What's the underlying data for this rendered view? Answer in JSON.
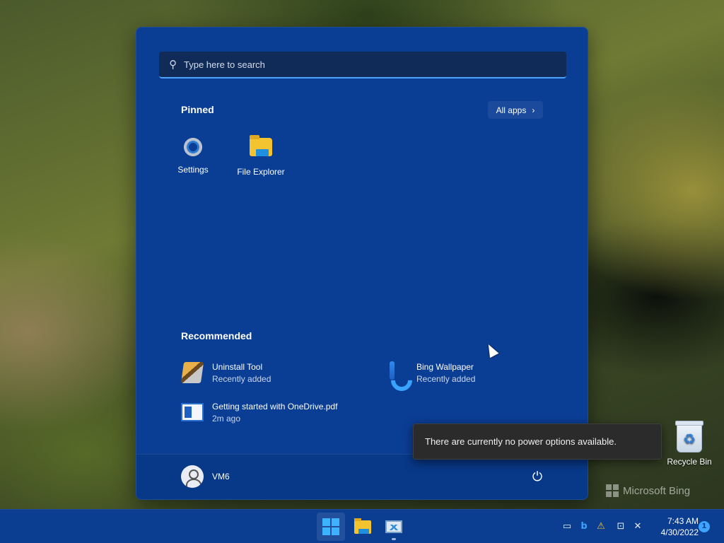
{
  "search": {
    "placeholder": "Type here to search"
  },
  "pinned": {
    "title": "Pinned",
    "all_apps_label": "All apps",
    "apps": [
      {
        "label": "Settings",
        "icon": "settings-gear-icon"
      },
      {
        "label": "File Explorer",
        "icon": "folder-icon"
      }
    ]
  },
  "recommended": {
    "title": "Recommended",
    "items": [
      {
        "title": "Uninstall Tool",
        "subtitle": "Recently added",
        "icon": "uninstall-tool-icon"
      },
      {
        "title": "Bing Wallpaper",
        "subtitle": "Recently added",
        "icon": "bing-icon"
      },
      {
        "title": "Getting started with OneDrive.pdf",
        "subtitle": "2m ago",
        "icon": "document-icon"
      }
    ]
  },
  "user": {
    "name": "VM6"
  },
  "tooltip": {
    "text": "There are currently no power options available."
  },
  "desktop": {
    "recycle_bin_label": "Recycle Bin",
    "wallpaper_brand": "Microsoft Bing"
  },
  "taskbar": {
    "clock_time": "7:43 AM",
    "clock_date": "4/30/2022",
    "notification_count": "1"
  },
  "colors": {
    "start_menu_bg": "#0a3d94",
    "taskbar_bg": "#0b3d91",
    "accent": "#4da3ff"
  }
}
